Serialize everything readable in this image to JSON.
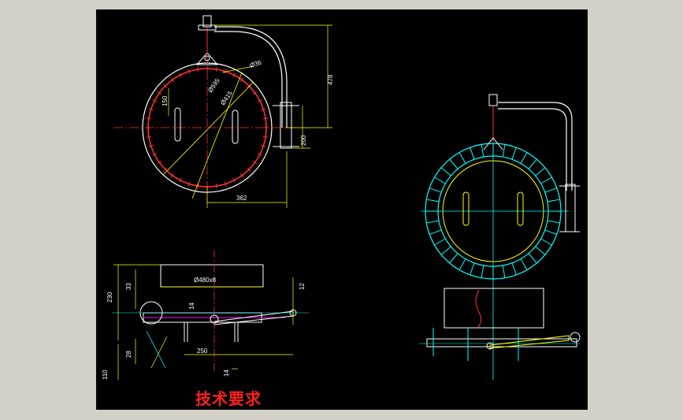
{
  "colors": {
    "background": "#d4d0c8",
    "canvas": "#000000",
    "outline": "#ffffff",
    "dimension": "#ffff00",
    "centerline": "#ff3030",
    "hidden": "#00ffff",
    "accent": "#ff00ff",
    "note": "#ff2020"
  },
  "front_view": {
    "dimensions": {
      "arc": "Ø36",
      "outer_dia": "Ø595",
      "inner_dia": "Ø415",
      "height": "478",
      "slot": "150",
      "offset": "200",
      "width": "362"
    }
  },
  "side_view": {
    "dimensions": {
      "pipe": "Ø480x8",
      "h1": "33",
      "total_height": "230",
      "d14_top": "14",
      "d12": "12",
      "d28": "28",
      "length": "250",
      "d14_bottom": "14",
      "d110": "110"
    }
  },
  "technical_requirements": "技术要求"
}
